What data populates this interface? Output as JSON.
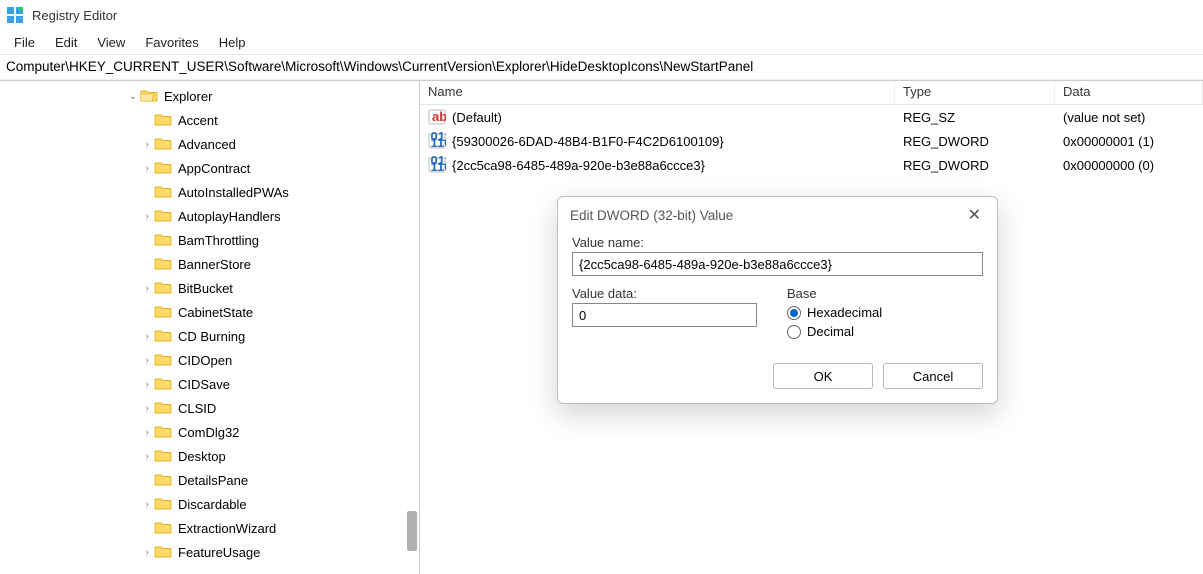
{
  "app": {
    "title": "Registry Editor"
  },
  "menu": {
    "items": [
      "File",
      "Edit",
      "View",
      "Favorites",
      "Help"
    ]
  },
  "address": {
    "path": "Computer\\HKEY_CURRENT_USER\\Software\\Microsoft\\Windows\\CurrentVersion\\Explorer\\HideDesktopIcons\\NewStartPanel"
  },
  "tree": {
    "items": [
      {
        "label": "Explorer",
        "depth": 9,
        "expander": "down",
        "open": true
      },
      {
        "label": "Accent",
        "depth": 10,
        "expander": ""
      },
      {
        "label": "Advanced",
        "depth": 10,
        "expander": "right"
      },
      {
        "label": "AppContract",
        "depth": 10,
        "expander": "right"
      },
      {
        "label": "AutoInstalledPWAs",
        "depth": 10,
        "expander": ""
      },
      {
        "label": "AutoplayHandlers",
        "depth": 10,
        "expander": "right"
      },
      {
        "label": "BamThrottling",
        "depth": 10,
        "expander": ""
      },
      {
        "label": "BannerStore",
        "depth": 10,
        "expander": ""
      },
      {
        "label": "BitBucket",
        "depth": 10,
        "expander": "right"
      },
      {
        "label": "CabinetState",
        "depth": 10,
        "expander": ""
      },
      {
        "label": "CD Burning",
        "depth": 10,
        "expander": "right"
      },
      {
        "label": "CIDOpen",
        "depth": 10,
        "expander": "right"
      },
      {
        "label": "CIDSave",
        "depth": 10,
        "expander": "right"
      },
      {
        "label": "CLSID",
        "depth": 10,
        "expander": "right"
      },
      {
        "label": "ComDlg32",
        "depth": 10,
        "expander": "right"
      },
      {
        "label": "Desktop",
        "depth": 10,
        "expander": "right"
      },
      {
        "label": "DetailsPane",
        "depth": 10,
        "expander": ""
      },
      {
        "label": "Discardable",
        "depth": 10,
        "expander": "right"
      },
      {
        "label": "ExtractionWizard",
        "depth": 10,
        "expander": ""
      },
      {
        "label": "FeatureUsage",
        "depth": 10,
        "expander": "right"
      }
    ]
  },
  "list": {
    "columns": {
      "name": "Name",
      "type": "Type",
      "data": "Data"
    },
    "rows": [
      {
        "icon": "string",
        "name": "(Default)",
        "type": "REG_SZ",
        "data": "(value not set)"
      },
      {
        "icon": "dword",
        "name": "{59300026-6DAD-48B4-B1F0-F4C2D6100109}",
        "type": "REG_DWORD",
        "data": "0x00000001 (1)"
      },
      {
        "icon": "dword",
        "name": "{2cc5ca98-6485-489a-920e-b3e88a6ccce3}",
        "type": "REG_DWORD",
        "data": "0x00000000 (0)"
      }
    ]
  },
  "dialog": {
    "title": "Edit DWORD (32-bit) Value",
    "value_name_label": "Value name:",
    "value_name": "{2cc5ca98-6485-489a-920e-b3e88a6ccce3}",
    "value_data_label": "Value data:",
    "value_data": "0",
    "base_label": "Base",
    "hex_label": "Hexadecimal",
    "dec_label": "Decimal",
    "base_selected": "hex",
    "ok": "OK",
    "cancel": "Cancel",
    "close_glyph": "✕"
  }
}
